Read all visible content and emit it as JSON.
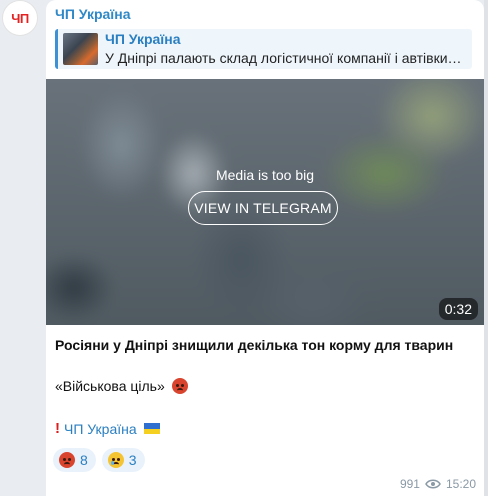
{
  "channel": {
    "avatar_text": "ЧП",
    "name": "ЧП Україна",
    "brand_color": "#2f88c7"
  },
  "forward": {
    "title": "ЧП Україна",
    "text": "У Дніпрі палають склад логістичної компанії і автівки…"
  },
  "media": {
    "label": "Media is too big",
    "button": "VIEW IN TELEGRAM",
    "duration": "0:32"
  },
  "post": {
    "title": "Росіяни у Дніпрі знищили декілька тон корму для тварин",
    "quote": "«Військова ціль»"
  },
  "signature": {
    "text": "ЧП Україна"
  },
  "reactions": [
    {
      "icon": "angry-face-icon",
      "count": "8"
    },
    {
      "icon": "crying-face-icon",
      "count": "3"
    }
  ],
  "meta": {
    "views": "991",
    "time": "15:20"
  }
}
